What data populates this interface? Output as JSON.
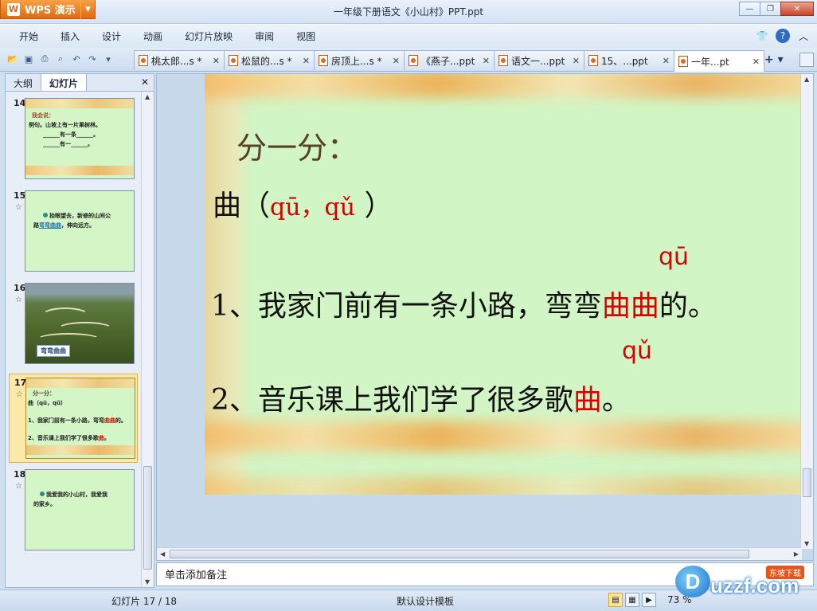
{
  "app": {
    "brand": "WPS 演示",
    "window_title": "一年级下册语文《小山村》PPT.ppt"
  },
  "window_controls": [
    "—",
    "❐",
    "✕"
  ],
  "menu": [
    "开始",
    "插入",
    "设计",
    "动画",
    "幻灯片放映",
    "审阅",
    "视图"
  ],
  "doc_tabs": [
    {
      "label": "桃太郎...s *"
    },
    {
      "label": "松鼠的...s *"
    },
    {
      "label": "房顶上...s *"
    },
    {
      "label": "《燕子...ppt"
    },
    {
      "label": "语文一...ppt"
    },
    {
      "label": "15、...ppt"
    },
    {
      "label": "一年...pt",
      "active": true
    }
  ],
  "left_pane": {
    "tabs": [
      "大纲",
      "幻灯片"
    ],
    "active_tab": "幻灯片",
    "thumbnails": [
      {
        "num": "14",
        "star": "",
        "lines": [
          "我会说：",
          "例句。山坡上有一片果树林。",
          "______有一条______。",
          "______有一______。"
        ]
      },
      {
        "num": "15",
        "star": "☆",
        "lines": [
          "抬眼望去，新修的山间公",
          "路",
          "弯弯曲曲",
          "，伸向远方。"
        ]
      },
      {
        "num": "16",
        "star": "☆",
        "caption": "弯弯曲曲"
      },
      {
        "num": "17",
        "star": "☆",
        "selected": true,
        "lines": [
          "分一分：",
          "曲（qū，qǔ）",
          "1、我家门前有一条小路，弯弯",
          "曲曲",
          "的。",
          "2、音乐课上我们学了很多歌",
          "曲",
          "。"
        ]
      },
      {
        "num": "18",
        "star": "☆",
        "lines": [
          "我爱我的小山村，我爱我",
          "的家乡。"
        ]
      }
    ]
  },
  "slide": {
    "title": "分一分：",
    "char": "曲（",
    "readings": "qū，qǔ",
    "char_close": "）",
    "line1_prefix": "1、我家门前有一条小路，弯弯",
    "line1_red": "曲曲",
    "line1_suffix": "的。",
    "line1_pinyin": "qū",
    "line2_prefix": "2、音乐课上我们学了很多歌",
    "line2_red": "曲",
    "line2_suffix": "。",
    "line2_pinyin": "qǔ"
  },
  "notes_placeholder": "单击添加备注",
  "status": {
    "slide_info": "幻灯片 17 / 18",
    "template": "默认设计模板",
    "zoom": "73 %"
  },
  "watermark": {
    "logo": "D",
    "text": "uzzf.com",
    "tag": "东坡下载"
  }
}
